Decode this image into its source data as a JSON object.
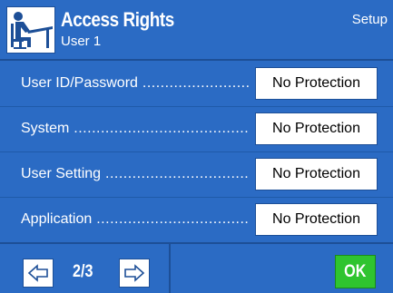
{
  "header": {
    "title": "Access Rights",
    "subtitle": "User 1",
    "right_label": "Setup",
    "icon": "user-at-desk-icon"
  },
  "rows": [
    {
      "label": "User ID/Password",
      "value": "No Protection"
    },
    {
      "label": "System",
      "value": "No Protection"
    },
    {
      "label": "User Setting",
      "value": "No Protection"
    },
    {
      "label": "Application",
      "value": "No Protection"
    }
  ],
  "footer": {
    "page_indicator": "2/3",
    "prev_icon": "arrow-left-icon",
    "next_icon": "arrow-right-icon",
    "ok_label": "OK"
  },
  "colors": {
    "background": "#2b6bc4",
    "ok_button": "#2fc42f"
  }
}
